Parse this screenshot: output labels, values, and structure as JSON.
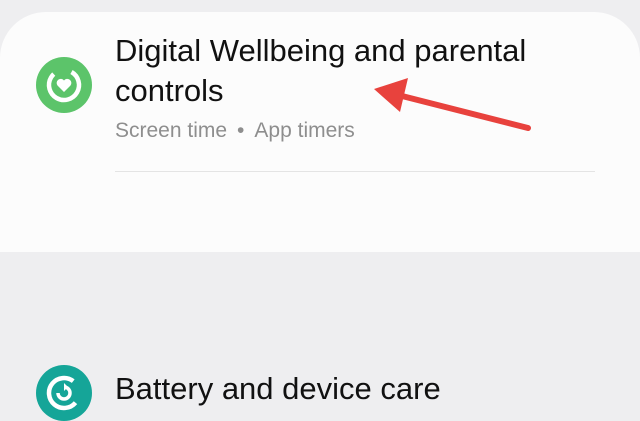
{
  "settings": {
    "wellbeing": {
      "title": "Digital Wellbeing and parental controls",
      "subtitle_a": "Screen time",
      "subtitle_sep": "•",
      "subtitle_b": "App timers",
      "icon": "wellbeing-heart-icon",
      "icon_color": "#5cc46a"
    },
    "battery": {
      "title": "Battery and device care",
      "icon": "device-care-icon",
      "icon_color": "#15a598"
    }
  },
  "annotation": {
    "arrow_color": "#e8423d"
  }
}
